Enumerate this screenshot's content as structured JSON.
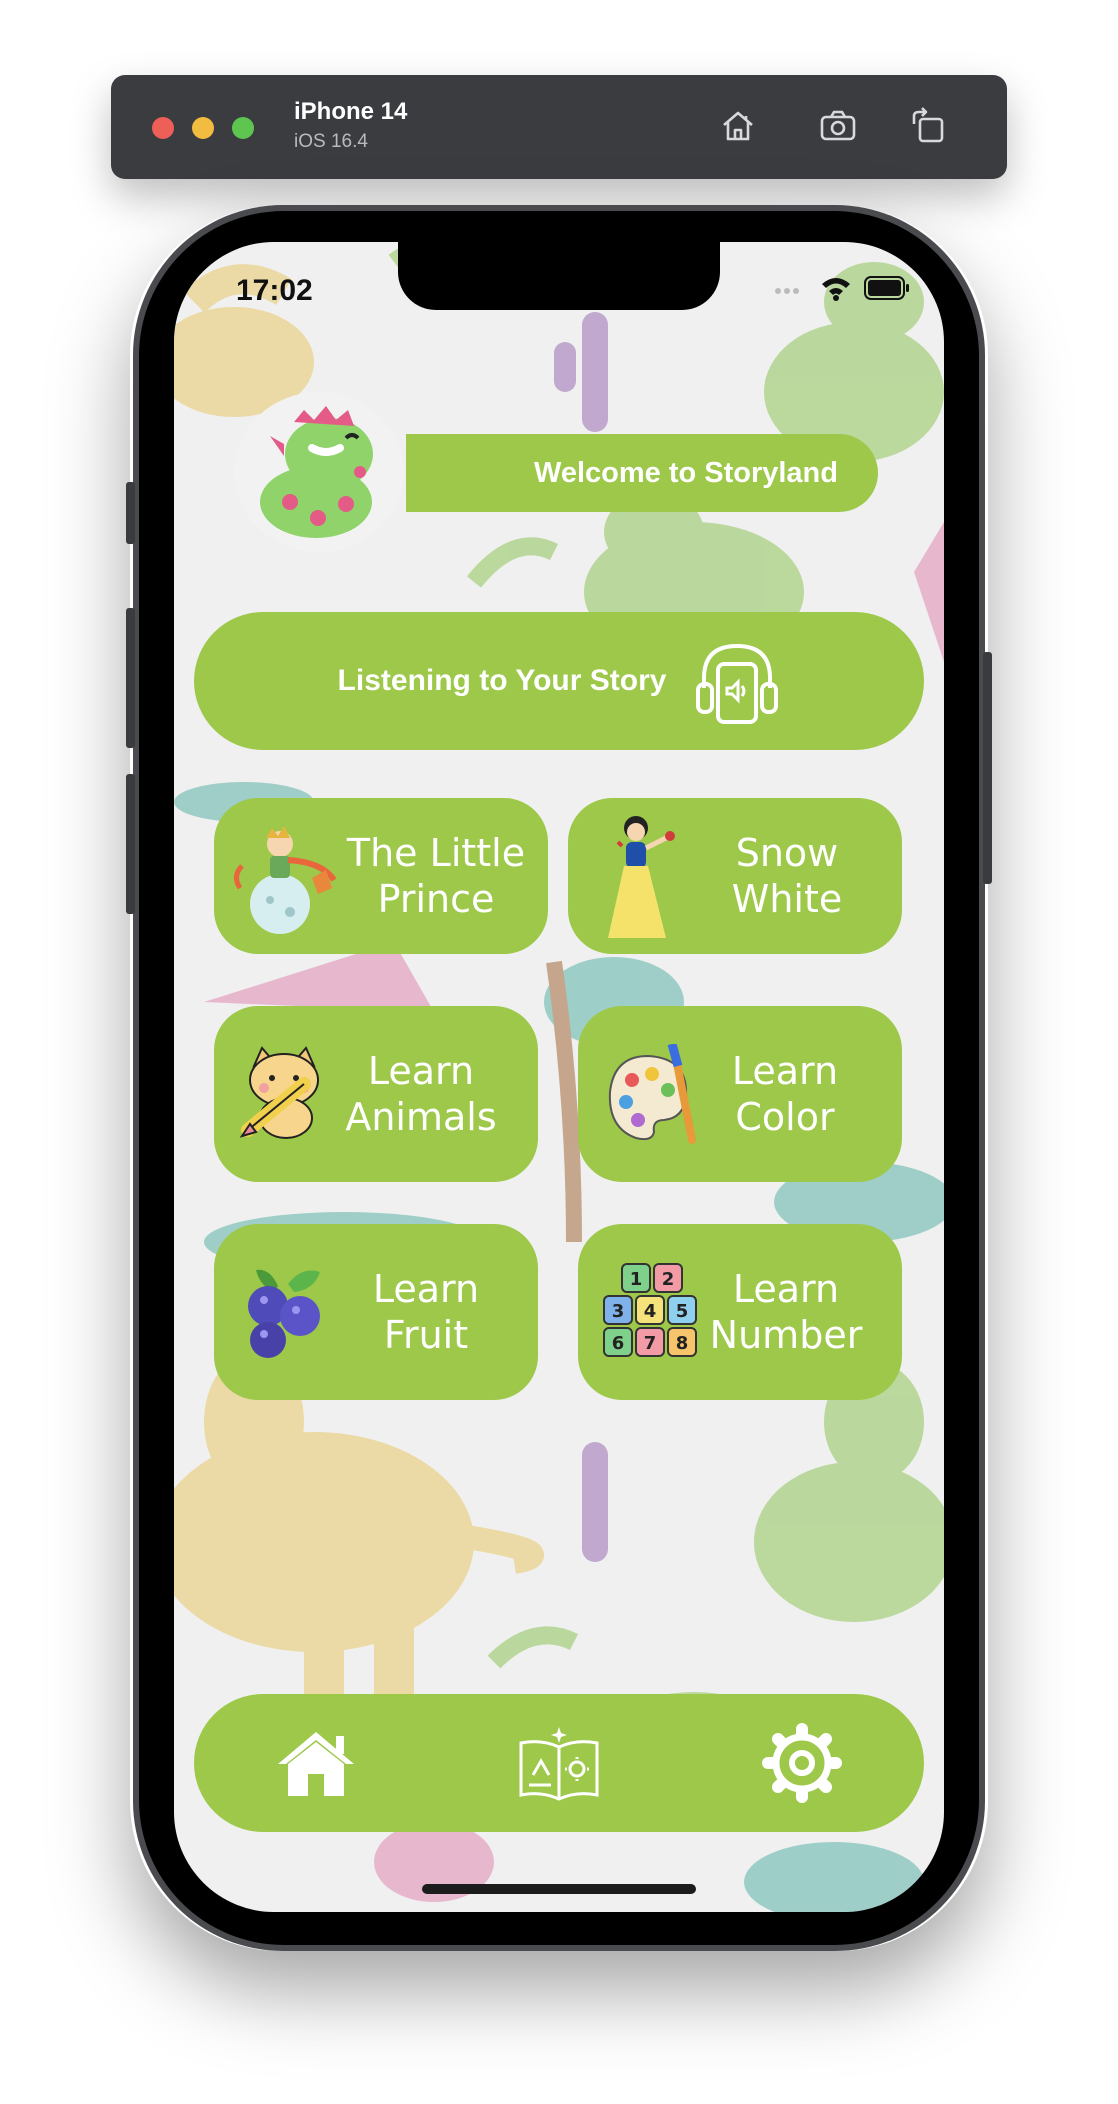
{
  "simulator": {
    "device_name": "iPhone 14",
    "os_version": "iOS 16.4",
    "toolbar_icons": [
      "home-icon",
      "screenshot-icon",
      "rotate-icon"
    ]
  },
  "status_bar": {
    "time": "17:02",
    "icons": [
      "signal-icon",
      "wifi-icon",
      "battery-icon"
    ]
  },
  "colors": {
    "accent": "#9dc84a",
    "text_on_accent": "#ffffff",
    "background": "#f0f0f0"
  },
  "header": {
    "welcome": "Welcome to Storyland",
    "avatar": "dinosaur-avatar"
  },
  "listen_button": {
    "label": "Listening to Your Story",
    "icon": "headphones-phone-icon"
  },
  "cards": [
    {
      "label_line1": "The Little",
      "label_line2": "Prince",
      "icon": "little-prince-illustration"
    },
    {
      "label_line1": "Snow",
      "label_line2": "White",
      "icon": "snow-white-illustration"
    },
    {
      "label_line1": "Learn",
      "label_line2": "Animals",
      "icon": "cat-pencil-icon"
    },
    {
      "label_line1": "Learn",
      "label_line2": "Color",
      "icon": "paint-palette-icon"
    },
    {
      "label": "Learn Fruit",
      "icon": "blueberries-icon"
    },
    {
      "label_line1": "Learn",
      "label_line2": "Number",
      "icon": "number-blocks-icon"
    }
  ],
  "blocks": [
    "1",
    "2",
    "3",
    "4",
    "5",
    "6",
    "7",
    "8"
  ],
  "bottom_nav": [
    "home-icon",
    "story-book-icon",
    "settings-gear-icon"
  ]
}
